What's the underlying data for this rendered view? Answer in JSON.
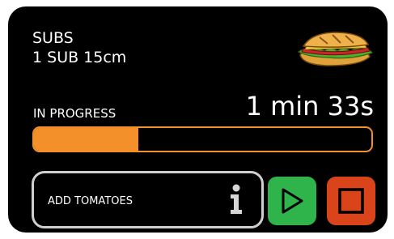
{
  "order": {
    "category": "SUBS",
    "portion": "1 SUB 15cm"
  },
  "status": {
    "label": "IN PROGRESS",
    "time_remaining": "1 min 33s",
    "progress_fraction": 0.31,
    "progress_color": "#f3902a"
  },
  "note": {
    "text": "ADD TOMATOES",
    "icon": "info-icon"
  },
  "controls": {
    "play": {
      "icon": "play-icon",
      "color": "#2fb34b"
    },
    "stop": {
      "icon": "stop-icon",
      "color": "#d9441b"
    }
  },
  "product_image": "sandwich-icon"
}
